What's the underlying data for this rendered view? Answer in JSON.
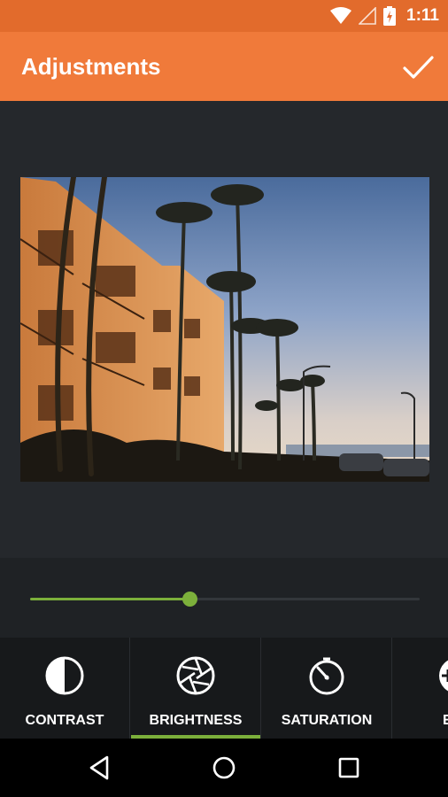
{
  "status_bar": {
    "time": "1:11",
    "icons": [
      "wifi-icon",
      "cellular-signal-icon",
      "battery-charging-icon"
    ]
  },
  "app_bar": {
    "title": "Adjustments",
    "confirm_icon": "checkmark-icon"
  },
  "photo": {
    "description_icon": "photo-preview"
  },
  "slider": {
    "value_fraction": 0.41
  },
  "tools": [
    {
      "label": "CONTRAST",
      "icon": "contrast-icon",
      "active": false
    },
    {
      "label": "BRIGHTNESS",
      "icon": "aperture-icon",
      "active": true
    },
    {
      "label": "SATURATION",
      "icon": "timer-icon",
      "active": false
    },
    {
      "label": "EXP",
      "icon": "exposure-icon",
      "active": false
    }
  ],
  "nav_bar": {
    "icons": [
      "back-icon",
      "home-icon",
      "recents-icon"
    ]
  },
  "colors": {
    "status_bar": "#e26b2c",
    "app_bar": "#f07a3a",
    "accent": "#7cb03b",
    "background": "#25282c"
  }
}
